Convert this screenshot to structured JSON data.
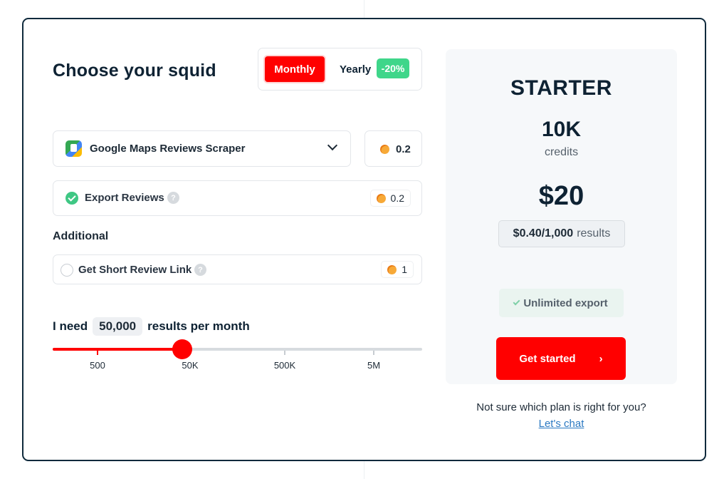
{
  "header": {
    "title": "Choose your squid"
  },
  "billing": {
    "monthly_label": "Monthly",
    "yearly_label": "Yearly",
    "yearly_discount": "-20%",
    "selected": "Monthly"
  },
  "scraper": {
    "selected": "Google Maps Reviews Scraper",
    "cost": "0.2",
    "icon": "google-maps-app-icon"
  },
  "options": {
    "export": {
      "label": "Export Reviews",
      "cost": "0.2",
      "checked": true
    },
    "additional_heading": "Additional",
    "short_link": {
      "label": "Get Short Review Link",
      "cost": "1",
      "checked": false
    }
  },
  "volume": {
    "prefix": "I need",
    "value": "50,000",
    "suffix": "results per month",
    "ticks": [
      "500",
      "50K",
      "500K",
      "5M"
    ],
    "level": 0.35
  },
  "plan": {
    "name": "STARTER",
    "credits": "10K",
    "credits_label": "credits",
    "price": "$20",
    "per_price": "$0.40/1,000",
    "per_unit": "results",
    "feature": "Unlimited export",
    "cta": "Get started",
    "cta_icon": "›"
  },
  "help": {
    "question": "Not sure which plan is right for you?",
    "link": "Let's chat"
  },
  "colors": {
    "accent": "#ff0000",
    "discount": "#3fd68a",
    "check": "#3fc784",
    "link": "#2b79c2"
  }
}
